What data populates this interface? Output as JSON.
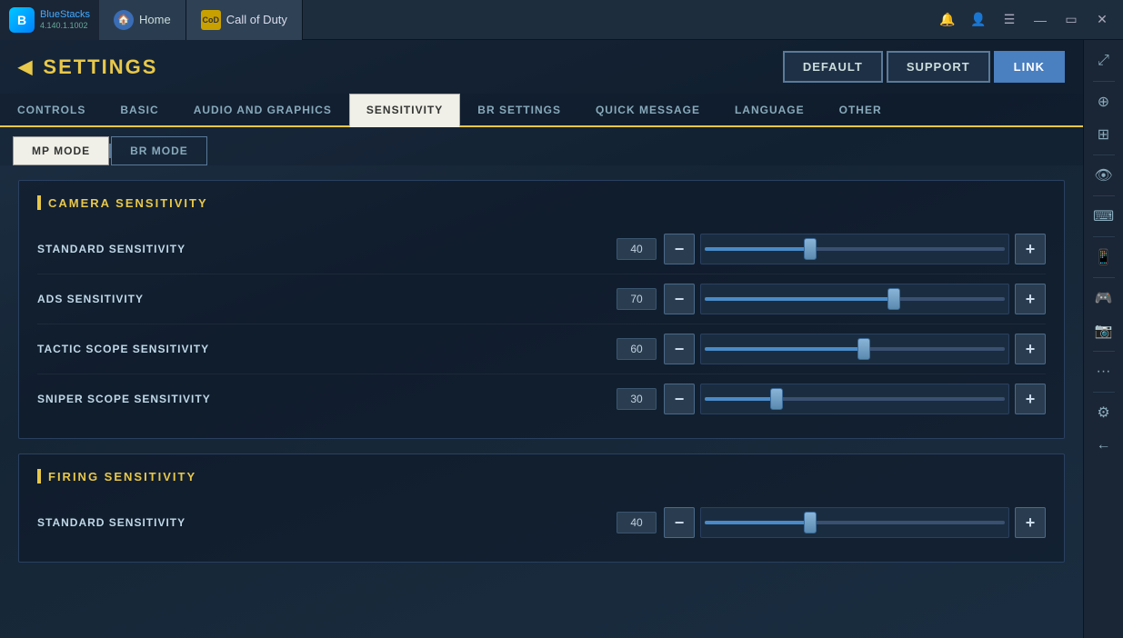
{
  "titlebar": {
    "bluestacks_name": "BlueStacks",
    "bluestacks_version": "4.140.1.1002",
    "tab_home": "Home",
    "tab_cod": "Call of Duty"
  },
  "settings": {
    "title": "SETTINGS",
    "btn_default": "DEFAULT",
    "btn_support": "SUPPORT",
    "btn_link": "LINK"
  },
  "tabs": [
    {
      "id": "controls",
      "label": "CONTROLS",
      "active": false
    },
    {
      "id": "basic",
      "label": "BASIC",
      "active": false
    },
    {
      "id": "audio-graphics",
      "label": "AUDIO AND GRAPHICS",
      "active": false
    },
    {
      "id": "sensitivity",
      "label": "SENSITIVITY",
      "active": true
    },
    {
      "id": "br-settings",
      "label": "BR SETTINGS",
      "active": false
    },
    {
      "id": "quick-message",
      "label": "QUICK MESSAGE",
      "active": false
    },
    {
      "id": "language",
      "label": "LANGUAGE",
      "active": false
    },
    {
      "id": "other",
      "label": "OTHER",
      "active": false
    }
  ],
  "modes": [
    {
      "id": "mp",
      "label": "MP MODE",
      "active": true
    },
    {
      "id": "br",
      "label": "BR MODE",
      "active": false
    }
  ],
  "camera_sensitivity": {
    "title": "CAMERA SENSITIVITY",
    "rows": [
      {
        "id": "standard",
        "label": "STANDARD SENSITIVITY",
        "value": "40",
        "fill_pct": 35
      },
      {
        "id": "ads",
        "label": "ADS SENSITIVITY",
        "value": "70",
        "fill_pct": 63
      },
      {
        "id": "tactic",
        "label": "TACTIC SCOPE SENSITIVITY",
        "value": "60",
        "fill_pct": 53
      },
      {
        "id": "sniper",
        "label": "SNIPER SCOPE SENSITIVITY",
        "value": "30",
        "fill_pct": 24
      }
    ]
  },
  "firing_sensitivity": {
    "title": "FIRING SENSITIVITY",
    "rows": [
      {
        "id": "std-fire",
        "label": "STANDARD SENSITIVITY",
        "value": "40",
        "fill_pct": 35
      }
    ]
  },
  "right_toolbar": {
    "icons": [
      "🔔",
      "👤",
      "☰",
      "—",
      "▭",
      "✕"
    ]
  }
}
